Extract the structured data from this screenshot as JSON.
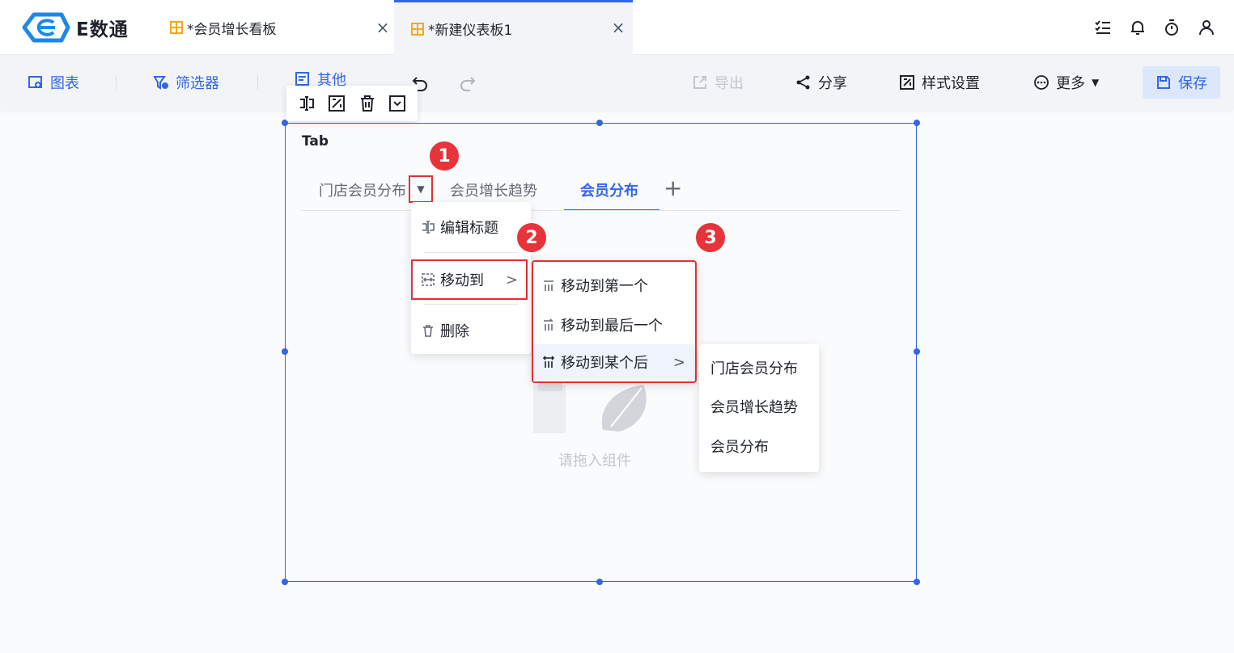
{
  "app": {
    "name": "E数通"
  },
  "tabs": [
    {
      "label": "*会员增长看板",
      "close": "×"
    },
    {
      "label": "*新建仪表板1",
      "close": "×"
    }
  ],
  "toolbar": {
    "chart": "图表",
    "filter": "筛选器",
    "other": "其他",
    "export": "导出",
    "share": "分享",
    "style": "样式设置",
    "more": "更多",
    "save": "保存"
  },
  "widget": {
    "title": "Tab",
    "tabs": [
      "门店会员分布",
      "会员增长趋势",
      "会员分布"
    ],
    "active_tab": "会员分布",
    "empty_hint": "请拖入组件"
  },
  "context_menu": {
    "edit_title": "编辑标题",
    "move_to": "移动到",
    "delete": "删除"
  },
  "move_menu": {
    "first": "移动到第一个",
    "last": "移动到最后一个",
    "after": "移动到某个后"
  },
  "after_menu": [
    "门店会员分布",
    "会员增长趋势",
    "会员分布"
  ],
  "badges": [
    "1",
    "2",
    "3"
  ],
  "colors": {
    "accent": "#3366e6",
    "highlight": "#e23030"
  }
}
